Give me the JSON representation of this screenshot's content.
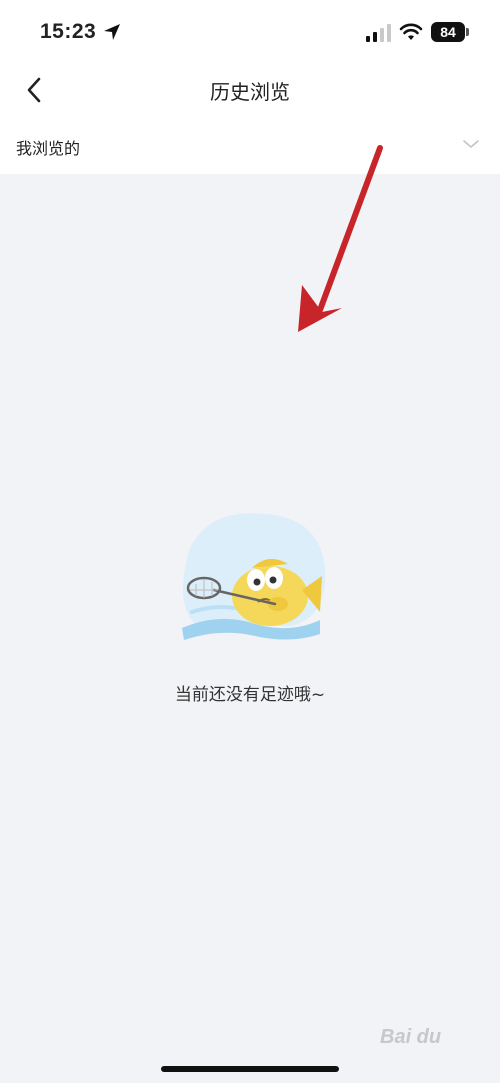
{
  "status_bar": {
    "time": "15:23",
    "battery": "84",
    "icons": [
      "location-arrow-icon",
      "signal-icon",
      "wifi-icon",
      "battery-icon"
    ]
  },
  "nav": {
    "title": "历史浏览",
    "back_icon": "chevron-left-icon"
  },
  "filter": {
    "label": "我浏览的",
    "dropdown_icon": "chevron-down-icon"
  },
  "empty_state": {
    "message": "当前还没有足迹哦~",
    "illustration": "fish-with-net-icon"
  },
  "overlay": {
    "annotation": "red-arrow-icon"
  },
  "colors": {
    "background": "#f2f3f7",
    "header": "#ffffff",
    "annotation_red": "#c8252a",
    "text_primary": "#222222"
  }
}
